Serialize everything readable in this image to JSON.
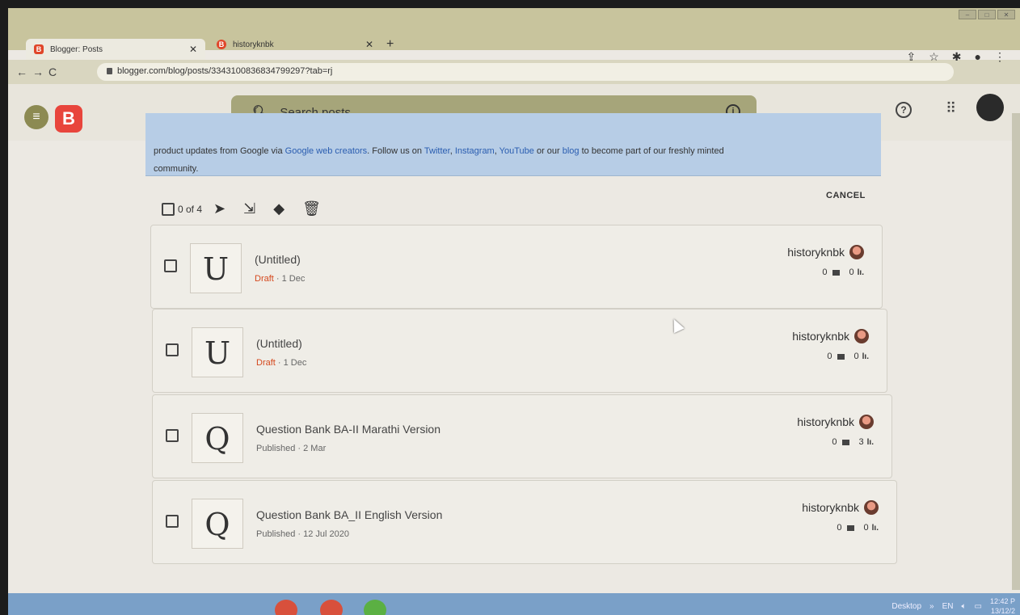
{
  "browser": {
    "tabs": [
      {
        "label": "Blogger: Posts",
        "favicon": "B"
      },
      {
        "label": "historyknbk",
        "favicon": "B"
      }
    ],
    "new_tab": "+",
    "url": "blogger.com/blog/posts/3343100836834799297?tab=rj"
  },
  "app": {
    "logo_letter": "B",
    "search_placeholder": "Search posts",
    "info_icon": "i",
    "help_icon": "?"
  },
  "banner": {
    "text_pre": "product updates from Google via ",
    "link1": "Google web creators",
    "text_mid1": ". Follow us on ",
    "link2": "Twitter",
    "sep1": ", ",
    "link3": "Instagram",
    "sep2": ", ",
    "link4": "YouTube",
    "text_mid2": " or our ",
    "link5": "blog",
    "text_post": " to become part of our freshly minted",
    "line2": "community."
  },
  "toolbar": {
    "count": "0 of 4",
    "cancel": "CANCEL"
  },
  "posts": [
    {
      "letter": "U",
      "title": "(Untitled)",
      "status": "Draft",
      "date": "1 Dec",
      "author": "historyknbk",
      "comments": "0",
      "views": "0"
    },
    {
      "letter": "U",
      "title": "(Untitled)",
      "status": "Draft",
      "date": "1 Dec",
      "author": "historyknbk",
      "comments": "0",
      "views": "0"
    },
    {
      "letter": "Q",
      "title": "Question Bank BA-II Marathi Version",
      "status": "Published",
      "date": "2 Mar",
      "author": "historyknbk",
      "comments": "0",
      "views": "3"
    },
    {
      "letter": "Q",
      "title": "Question Bank BA_II English Version",
      "status": "Published",
      "date": "12 Jul 2020",
      "author": "historyknbk",
      "comments": "0",
      "views": "0"
    }
  ],
  "taskbar": {
    "desktop": "Desktop",
    "lang": "EN",
    "time": "12:42 P",
    "date": "13/12/2"
  }
}
